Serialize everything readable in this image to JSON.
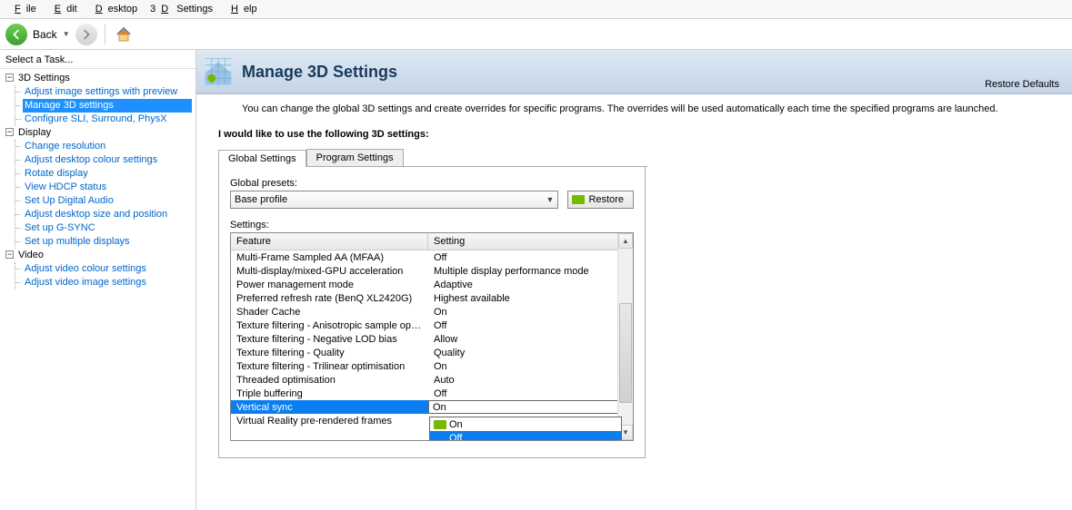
{
  "menu": [
    "File",
    "Edit",
    "Desktop",
    "3D Settings",
    "Help"
  ],
  "toolbar": {
    "back": "Back"
  },
  "sidebar": {
    "header": "Select a Task...",
    "groups": [
      {
        "label": "3D Settings",
        "items": [
          "Adjust image settings with preview",
          "Manage 3D settings",
          "Configure SLI, Surround, PhysX"
        ],
        "selectedIndex": 1
      },
      {
        "label": "Display",
        "items": [
          "Change resolution",
          "Adjust desktop colour settings",
          "Rotate display",
          "View HDCP status",
          "Set Up Digital Audio",
          "Adjust desktop size and position",
          "Set up G-SYNC",
          "Set up multiple displays"
        ],
        "selectedIndex": -1
      },
      {
        "label": "Video",
        "items": [
          "Adjust video colour settings",
          "Adjust video image settings"
        ],
        "selectedIndex": -1
      }
    ]
  },
  "header": {
    "title": "Manage 3D Settings",
    "restore": "Restore Defaults"
  },
  "intro": "You can change the global 3D settings and create overrides for specific programs. The overrides will be used automatically each time the specified programs are launched.",
  "sectionLabel": "I would like to use the following 3D settings:",
  "tabs": [
    "Global Settings",
    "Program Settings"
  ],
  "presets": {
    "label": "Global presets:",
    "value": "Base profile",
    "restore": "Restore"
  },
  "settings": {
    "label": "Settings:",
    "columns": [
      "Feature",
      "Setting"
    ],
    "rows": [
      {
        "f": "Multi-Frame Sampled AA (MFAA)",
        "s": "Off"
      },
      {
        "f": "Multi-display/mixed-GPU acceleration",
        "s": "Multiple display performance mode"
      },
      {
        "f": "Power management mode",
        "s": "Adaptive"
      },
      {
        "f": "Preferred refresh rate (BenQ XL2420G)",
        "s": "Highest available"
      },
      {
        "f": "Shader Cache",
        "s": "On"
      },
      {
        "f": "Texture filtering - Anisotropic sample opti...",
        "s": "Off"
      },
      {
        "f": "Texture filtering - Negative LOD bias",
        "s": "Allow"
      },
      {
        "f": "Texture filtering - Quality",
        "s": "Quality"
      },
      {
        "f": "Texture filtering - Trilinear optimisation",
        "s": "On"
      },
      {
        "f": "Threaded optimisation",
        "s": "Auto"
      },
      {
        "f": "Triple buffering",
        "s": "Off"
      },
      {
        "f": "Vertical sync",
        "s": "On",
        "selected": true
      },
      {
        "f": "Virtual Reality pre-rendered frames",
        "s": ""
      }
    ],
    "dropdown": {
      "options": [
        "On",
        "Off"
      ],
      "highlightIndex": 1
    }
  }
}
